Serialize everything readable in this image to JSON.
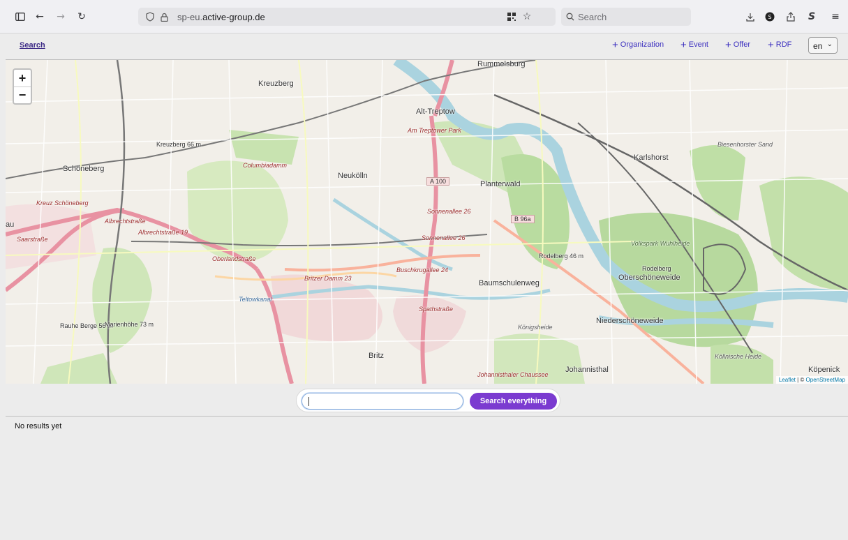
{
  "browser": {
    "url_host_prefix": "sp-eu.",
    "url_host_main": "active-group.de",
    "search_placeholder": "Search"
  },
  "app": {
    "search_link": "Search",
    "nav": [
      {
        "label": "Organization"
      },
      {
        "label": "Event"
      },
      {
        "label": "Offer"
      },
      {
        "label": "RDF"
      }
    ],
    "language": "en"
  },
  "map": {
    "labels": [
      "Rummelsburg",
      "Kreuzberg",
      "Alt-Treptow",
      "Am Treptower Park",
      "Kreuzberg 66 m",
      "Columbiadamm",
      "Schöneberg",
      "Neukölln",
      "Planterwald",
      "Karlshorst",
      "Biesenhorster Sand",
      "A 100",
      "B 96a",
      "Kreuz Schöneberg",
      "Albrechtstraße",
      "Albrechtstraße 19",
      "Sonnenallee 26",
      "Saarstraße",
      "au",
      "Oberlandstraße",
      "Rodelberg 46 m",
      "Volkspark Wuhlheide",
      "Oberschöneweide",
      "Rodelberg",
      "Baumschulenweg",
      "Buschkrugallee 24",
      "Britzer Damm 23",
      "Teltowkanal",
      "Spathstraße",
      "Königsheide",
      "Niederschöneweide",
      "Rauhe Berge 56 m",
      "Marienhöhe 73 m",
      "Britz",
      "Johannisthal",
      "Johannisthaler Chaussee",
      "Köllnische Heide",
      "Köpenick",
      "Sonnenallee 26"
    ],
    "attribution_leaflet": "Leaflet",
    "attribution_sep": " | © ",
    "attribution_osm": "OpenStreetMap",
    "zoom_in": "+",
    "zoom_out": "−"
  },
  "search": {
    "input_value": "",
    "button_label": "Search everything"
  },
  "results": {
    "status": "No results yet"
  },
  "colors": {
    "accent": "#7b3bd0",
    "nav_link": "#3b2fbf",
    "search_link": "#3c2a86"
  }
}
